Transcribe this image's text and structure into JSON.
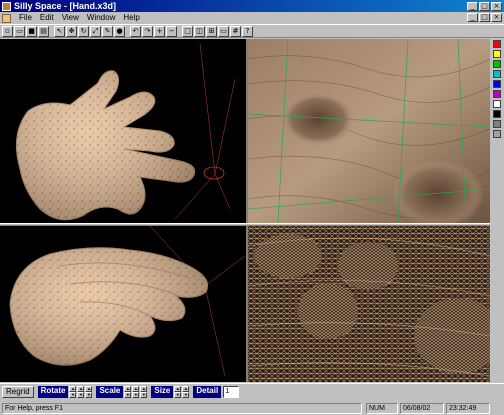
{
  "window": {
    "title": "Silly Space - [Hand.x3d]"
  },
  "titlebar_buttons": [
    "_",
    "□",
    "×"
  ],
  "menu": [
    "File",
    "Edit",
    "View",
    "Window",
    "Help"
  ],
  "mdi_buttons": [
    "_",
    "□",
    "×"
  ],
  "toolbar": [
    "new",
    "open",
    "save",
    "print",
    "select",
    "move",
    "rotate",
    "scale",
    "paint",
    "sphere",
    "undo",
    "redo",
    "zoom",
    "zoom-out",
    "view-single",
    "view-split",
    "view-quad",
    "view-wide",
    "wire",
    "help"
  ],
  "palette_colors": [
    "#ff0000",
    "#ffff00",
    "#00c000",
    "#00c0c0",
    "#0000ff",
    "#c000c0",
    "#ffffff",
    "#000000",
    "#808080",
    "#a0a0a0"
  ],
  "controls": {
    "button": "Regrid",
    "rotate": "Rotate",
    "scale": "Scale",
    "size": "Size",
    "detail": "Detail",
    "detail_value": "1"
  },
  "status": {
    "help": "For Help, press F1",
    "num": "NUM",
    "date": "06/08/02",
    "time": "23:32:49"
  },
  "colors": {
    "skin": "#e8c09a",
    "grid_green": "#2aa84a",
    "guide_red": "#d03030"
  }
}
